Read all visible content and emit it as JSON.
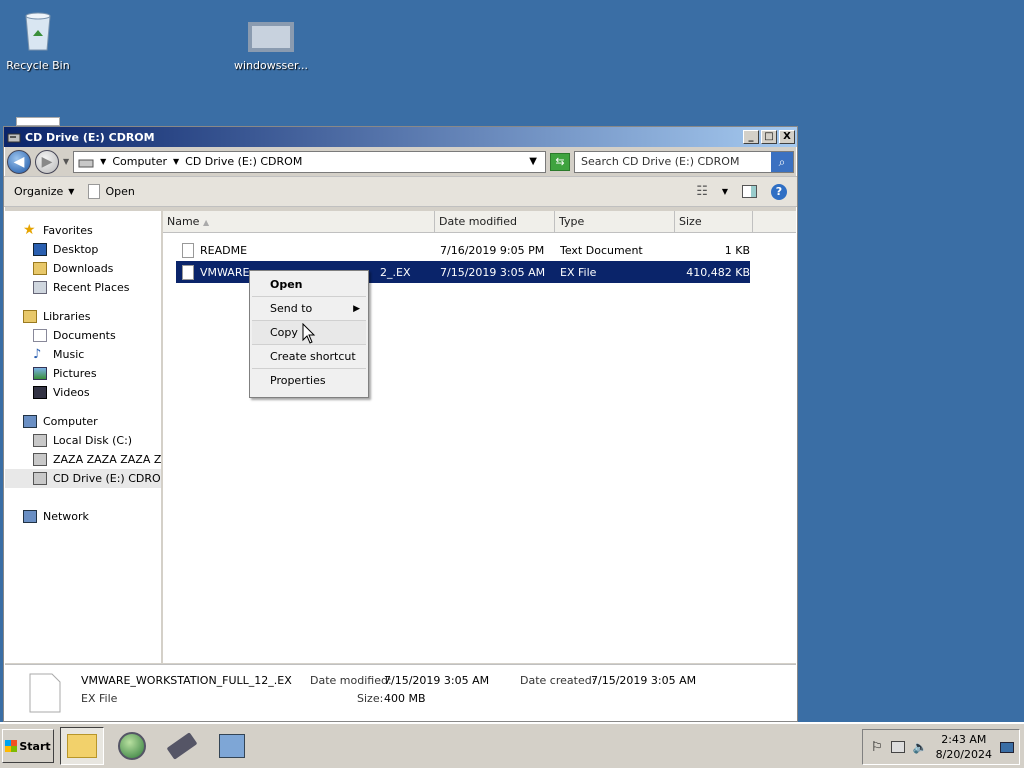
{
  "desktop": {
    "icons": [
      {
        "label": "Recycle Bin"
      },
      {
        "label": "windowsser..."
      }
    ]
  },
  "window": {
    "title": "CD Drive (E:) CDROM",
    "controls": {
      "minimize": "_",
      "maximize": "□",
      "close": "X"
    },
    "address": {
      "crumbs": [
        "Computer",
        "CD Drive (E:) CDROM"
      ]
    },
    "search_placeholder": "Search CD Drive (E:) CDROM",
    "toolbar": {
      "organize": "Organize",
      "open": "Open"
    },
    "nav": {
      "favorites": {
        "label": "Favorites",
        "items": [
          "Desktop",
          "Downloads",
          "Recent Places"
        ]
      },
      "libraries": {
        "label": "Libraries",
        "items": [
          "Documents",
          "Music",
          "Pictures",
          "Videos"
        ]
      },
      "computer": {
        "label": "Computer",
        "items": [
          "Local Disk (C:)",
          "ZAZA ZAZA ZAZA ZAZ",
          "CD Drive (E:) CDROM"
        ]
      },
      "network": {
        "label": "Network"
      }
    },
    "columns": [
      "Name",
      "Date modified",
      "Type",
      "Size"
    ],
    "files": [
      {
        "name": "README",
        "modified": "7/16/2019 9:05 PM",
        "type": "Text Document",
        "size": "1 KB",
        "selected": false
      },
      {
        "name": "VMWARE_WORKSTATION_FULL_12_.EX",
        "visible_name_start": "VMWARE_",
        "visible_name_end": "2_.EX",
        "modified": "7/15/2019 3:05 AM",
        "type": "EX File",
        "size": "410,482 KB",
        "selected": true
      }
    ],
    "context_menu": [
      "Open",
      "Send to",
      "Copy",
      "Create shortcut",
      "Properties"
    ],
    "details": {
      "name": "VMWARE_WORKSTATION_FULL_12_.EX",
      "type": "EX File",
      "modified_label": "Date modified:",
      "modified": "7/15/2019 3:05 AM",
      "created_label": "Date created:",
      "created": "7/15/2019 3:05 AM",
      "size_label": "Size:",
      "size": "400 MB"
    }
  },
  "taskbar": {
    "start": "Start",
    "clock": {
      "time": "2:43 AM",
      "date": "8/20/2024"
    }
  },
  "colors": {
    "desktop": "#3a6ea5",
    "selection": "#0a246a",
    "titlebar": "#0a246a"
  }
}
